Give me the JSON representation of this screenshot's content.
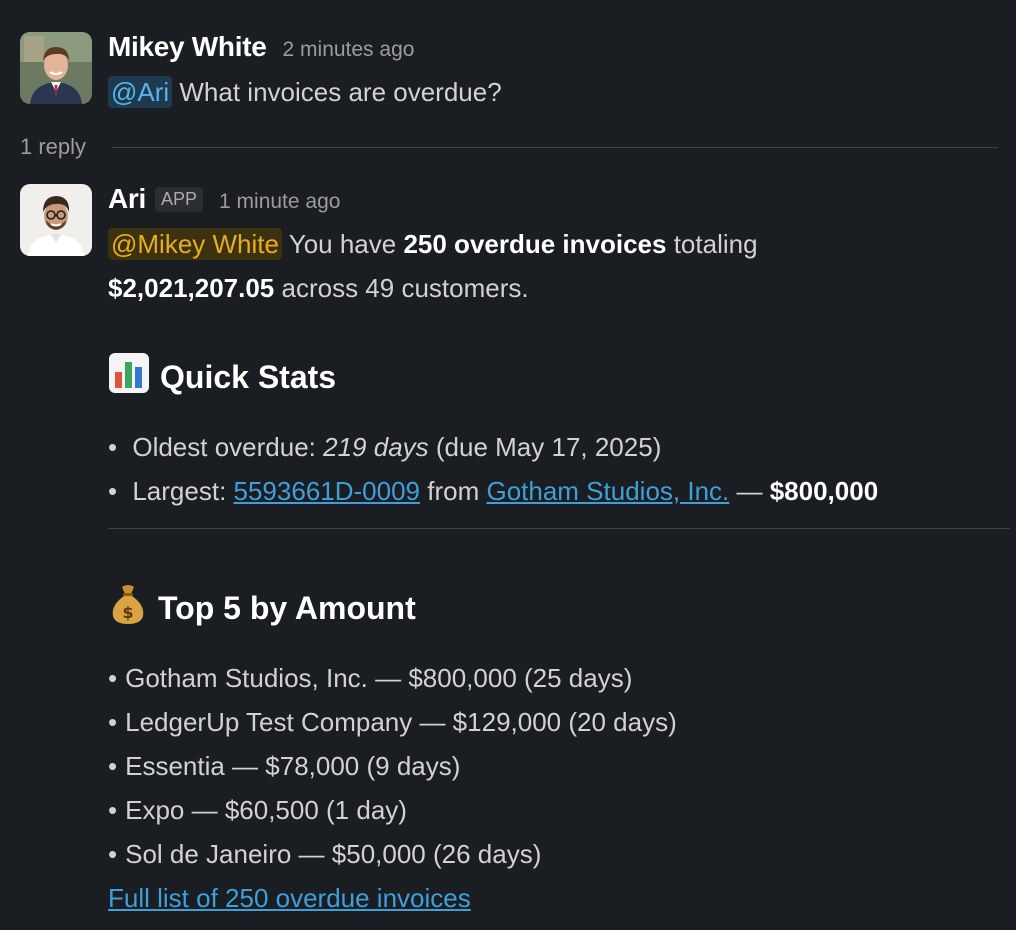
{
  "messages": {
    "first": {
      "author": "Mikey White",
      "time": "2 minutes ago",
      "mention": "@Ari",
      "text": " What invoices are overdue?"
    },
    "reply_count": "1 reply",
    "second": {
      "author": "Ari",
      "badge": "APP",
      "time": "1 minute ago",
      "mention": "@Mikey White",
      "text_1": " You have ",
      "strong_1": "250 overdue invoices",
      "text_2": " totaling",
      "strong_2": "$2,021,207.05",
      "text_3": " across 49 customers."
    }
  },
  "quick_stats": {
    "icon": "bar-chart-icon",
    "title": "Quick Stats",
    "oldest_label": "Oldest overdue: ",
    "oldest_value": "219 days",
    "oldest_due": " (due May 17, 2025)",
    "largest_label": "Largest: ",
    "largest_invoice": "5593661D-0009",
    "largest_from": " from ",
    "largest_customer": "Gotham Studios, Inc.",
    "largest_sep": " — ",
    "largest_amount": "$800,000"
  },
  "top5": {
    "icon": "money-bag-icon",
    "title": "Top 5 by Amount",
    "items": [
      "Gotham Studios, Inc. — $800,000 (25 days)",
      "LedgerUp Test Company — $129,000 (20 days)",
      "Essentia — $78,000 (9 days)",
      "Expo — $60,500 (1 day)",
      "Sol de Janeiro — $50,000 (26 days)"
    ],
    "full_list_link": "Full list of 250 overdue invoices"
  },
  "colors": {
    "background": "#1a1d21",
    "link": "#3f9fd9",
    "mention_blue": "#5ab3e8",
    "mention_yellow": "#e8ac21"
  }
}
